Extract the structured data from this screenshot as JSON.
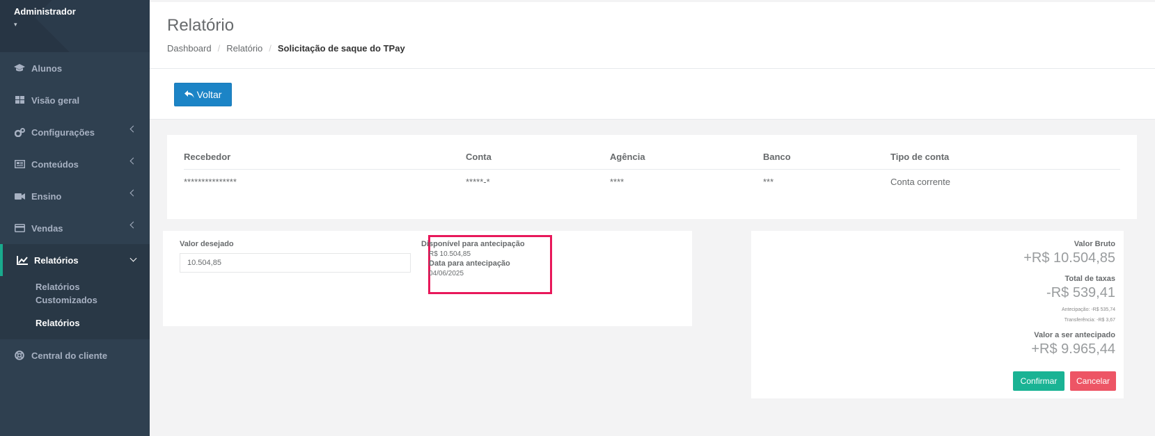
{
  "sidebar": {
    "user_name": "Administrador",
    "caret": "▾",
    "items": [
      {
        "label": "Alunos",
        "icon": "graduation-cap-icon"
      },
      {
        "label": "Visão geral",
        "icon": "grid-icon"
      },
      {
        "label": "Configurações",
        "icon": "gears-icon"
      },
      {
        "label": "Conteúdos",
        "icon": "newspaper-icon"
      },
      {
        "label": "Ensino",
        "icon": "video-camera-icon"
      },
      {
        "label": "Vendas",
        "icon": "credit-card-icon"
      },
      {
        "label": "Relatórios",
        "icon": "line-chart-icon"
      },
      {
        "label": "Central do cliente",
        "icon": "lifebuoy-icon"
      }
    ],
    "sub_items": [
      "Relatórios Customizados",
      "Relatórios"
    ]
  },
  "header": {
    "title": "Relatório",
    "breadcrumb": [
      "Dashboard",
      "Relatório",
      "Solicitação de saque do TPay"
    ],
    "separator": "/"
  },
  "actions": {
    "back_label": "Voltar"
  },
  "account_table": {
    "headers": [
      "Recebedor",
      "Conta",
      "Agência",
      "Banco",
      "Tipo de conta"
    ],
    "row": [
      "***************",
      "*****-*",
      "****",
      "***",
      "Conta corrente"
    ]
  },
  "form": {
    "desired_label": "Valor desejado",
    "desired_value": "10.504,85",
    "available_label": "Disponível para antecipação",
    "available_value": "R$ 10.504,85",
    "date_label": "Data para antecipação",
    "date_value": "04/06/2025"
  },
  "summary": {
    "gross_label": "Valor Bruto",
    "gross_value": "+R$ 10.504,85",
    "fees_label": "Total de taxas",
    "fees_value": "-R$ 539,41",
    "fee_advance": "Antecipação: -R$ 535,74",
    "fee_transfer": "Transferência: -R$ 3,67",
    "net_label": "Valor a ser antecipado",
    "net_value": "+R$ 9.965,44",
    "confirm_label": "Confirmar",
    "cancel_label": "Cancelar"
  },
  "colors": {
    "sidebar": "#2f4050",
    "primary": "#1c84c6",
    "confirm": "#1ab394",
    "cancel": "#ed5565",
    "highlight": "#e8185a"
  }
}
